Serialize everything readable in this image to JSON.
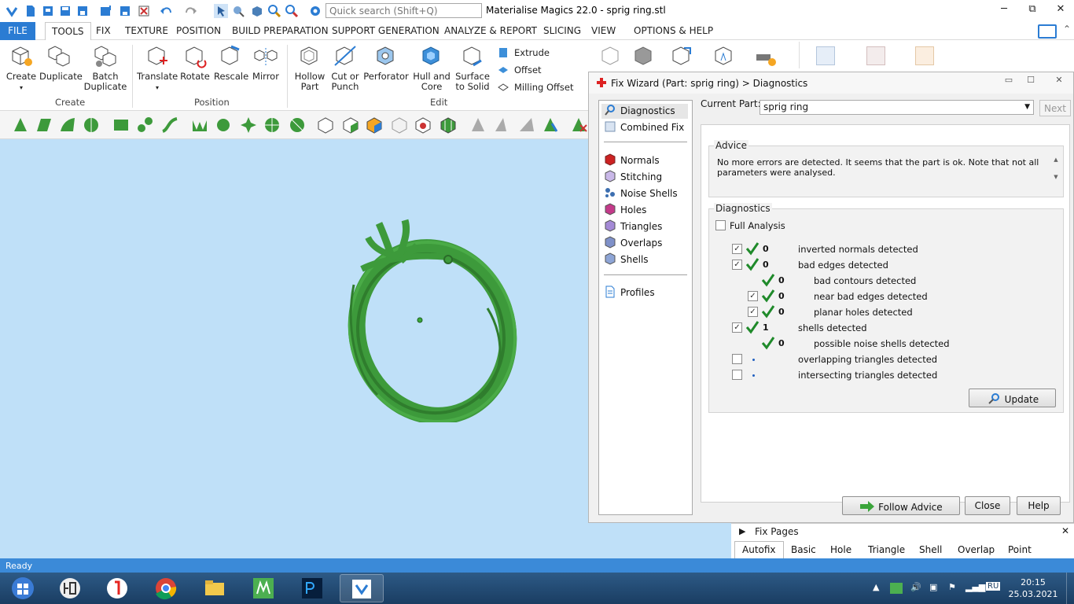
{
  "app": {
    "title": "Materialise Magics 22.0 - sprig ring.stl",
    "search_placeholder": "Quick search (Shift+Q)",
    "window_controls": {
      "minimize": "─",
      "restore": "⧉",
      "close": "✕"
    }
  },
  "menu": {
    "file": "FILE",
    "items": [
      "TOOLS",
      "FIX",
      "TEXTURE",
      "POSITION",
      "BUILD PREPARATION",
      "SUPPORT GENERATION",
      "ANALYZE & REPORT",
      "SLICING",
      "VIEW",
      "OPTIONS & HELP"
    ],
    "active": "TOOLS"
  },
  "ribbon": {
    "create_group": {
      "label": "Create",
      "create": "Create",
      "duplicate": "Duplicate",
      "batch_duplicate_1": "Batch",
      "batch_duplicate_2": "Duplicate"
    },
    "position_group": {
      "label": "Position",
      "translate": "Translate",
      "rotate": "Rotate",
      "rescale": "Rescale",
      "mirror": "Mirror"
    },
    "edit_group": {
      "label": "Edit",
      "hollow_1": "Hollow",
      "hollow_2": "Part",
      "cut_1": "Cut or",
      "cut_2": "Punch",
      "perforator": "Perforator",
      "hull_1": "Hull and",
      "hull_2": "Core",
      "surface_1": "Surface",
      "surface_2": "to Solid",
      "extrude": "Extrude",
      "offset": "Offset",
      "milling_offset": "Milling Offset"
    }
  },
  "fix_wizard": {
    "title": "Fix Wizard (Part: sprig ring) > Diagnostics",
    "nav": {
      "diagnostics": "Diagnostics",
      "combined_fix": "Combined Fix",
      "normals": "Normals",
      "stitching": "Stitching",
      "noise_shells": "Noise Shells",
      "holes": "Holes",
      "triangles": "Triangles",
      "overlaps": "Overlaps",
      "shells": "Shells",
      "profiles": "Profiles"
    },
    "current_part_label": "Current Part:",
    "current_part_value": "sprig ring",
    "next_label": "Next",
    "advice": {
      "title": "Advice",
      "text": "No more errors are detected. It seems that the part is ok. Note that not all parameters were analysed."
    },
    "diagnostics": {
      "title": "Diagnostics",
      "full_analysis": "Full Analysis",
      "rows": [
        {
          "count": "0",
          "label": "inverted normals detected"
        },
        {
          "count": "0",
          "label": "bad edges detected"
        },
        {
          "count": "0",
          "label": "bad contours detected"
        },
        {
          "count": "0",
          "label": "near bad edges detected"
        },
        {
          "count": "0",
          "label": "planar holes detected"
        },
        {
          "count": "1",
          "label": "shells detected"
        },
        {
          "count": "0",
          "label": "possible noise shells detected"
        },
        {
          "count": "",
          "label": "overlapping triangles detected"
        },
        {
          "count": "",
          "label": "intersecting triangles detected"
        }
      ],
      "update_label": "Update"
    },
    "follow_advice": "Follow Advice",
    "close": "Close",
    "help": "Help"
  },
  "fix_pages": {
    "title": "Fix Pages",
    "tabs": [
      "Autofix",
      "Basic",
      "Hole",
      "Triangle",
      "Shell",
      "Overlap",
      "Point"
    ],
    "active": "Autofix"
  },
  "status": "Ready",
  "tray": {
    "lang": "RU",
    "time": "20:15",
    "date": "25.03.2021"
  },
  "colors": {
    "accent": "#2b7cd3",
    "viewport": "#bfe0f8",
    "ring_green": "#3d9a3b",
    "check_green": "#1f8a2a"
  }
}
